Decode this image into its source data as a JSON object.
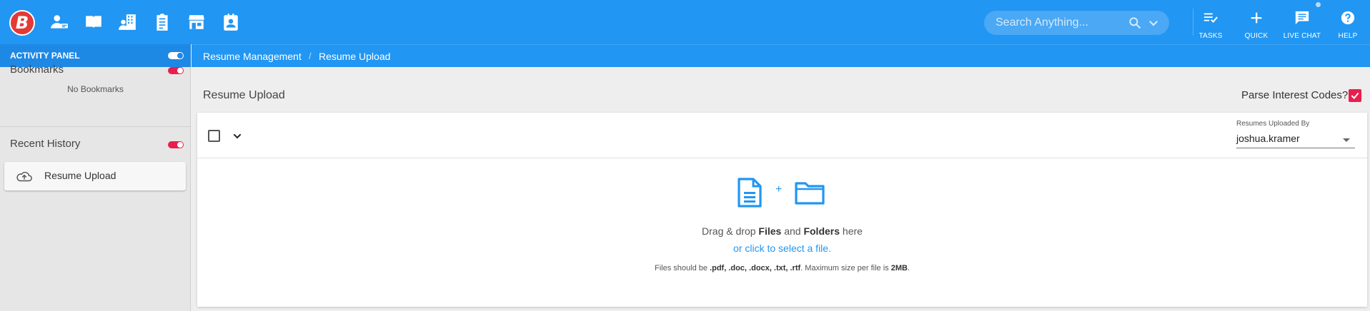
{
  "app": {
    "logo_letter": "B"
  },
  "search": {
    "placeholder": "Search Anything..."
  },
  "tools": [
    {
      "label": "TASKS",
      "icon": "tasks-icon"
    },
    {
      "label": "QUICK",
      "icon": "plus-icon"
    },
    {
      "label": "LIVE CHAT",
      "icon": "chat-icon"
    },
    {
      "label": "HELP",
      "icon": "help-icon"
    }
  ],
  "sidebar": {
    "activity_title": "ACTIVITY PANEL",
    "bookmarks_title": "Bookmarks",
    "bookmarks_empty": "No Bookmarks",
    "history_title": "Recent History",
    "history_items": [
      {
        "label": "Resume Upload",
        "icon": "cloud-upload-icon"
      }
    ]
  },
  "breadcrumb": {
    "items": [
      "Resume Management",
      "Resume Upload"
    ],
    "separator": "/"
  },
  "main": {
    "title": "Resume Upload",
    "parse_label": "Parse Interest Codes?",
    "parse_checked": true,
    "uploaded_by_label": "Resumes Uploaded By",
    "uploaded_by_value": "joshua.kramer",
    "drop": {
      "text_1": "Drag & drop ",
      "files": "Files",
      "text_2": " and ",
      "folders": "Folders",
      "text_3": " here",
      "link": "or click to select a file.",
      "note_1": "Files should be ",
      "note_types": ".pdf, .doc, .docx, .txt, .rtf",
      "note_2": ". Maximum size per file is ",
      "note_size": "2MB",
      "note_3": ".",
      "plus": "+"
    }
  },
  "colors": {
    "primary": "#2196f3",
    "accent_red": "#e91e4e",
    "logo_red": "#e53935"
  }
}
